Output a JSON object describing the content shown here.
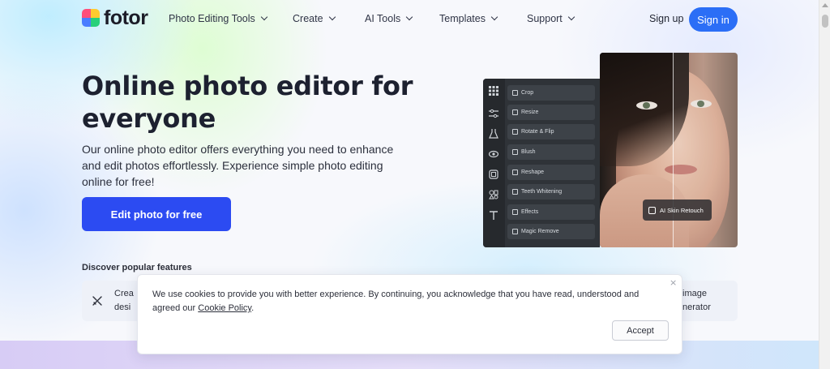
{
  "brand": {
    "name": "fotor"
  },
  "nav": {
    "items": [
      {
        "label": "Photo Editing Tools"
      },
      {
        "label": "Create"
      },
      {
        "label": "AI Tools"
      },
      {
        "label": "Templates"
      },
      {
        "label": "Support"
      }
    ],
    "signup_label": "Sign up",
    "signin_label": "Sign in"
  },
  "hero": {
    "title": "Online photo editor for everyone",
    "description": "Our online photo editor offers everything you need to enhance and edit photos effortlessly. Experience simple photo editing online for free!",
    "cta_label": "Edit photo for free"
  },
  "features": {
    "heading": "Discover popular features",
    "left_card_text": "Crea\ndesi",
    "right_card_text": "image\nnerator"
  },
  "editor_demo": {
    "tools": [
      "Crop",
      "Resize",
      "Rotate & Flip",
      "Blush",
      "Reshape",
      "Teeth Whitening",
      "Effects",
      "Magic Remove"
    ],
    "badge_label": "AI Skin Retouch"
  },
  "cookie": {
    "text": "We use cookies to provide you with better experience. By continuing, you acknowledge that you have read, understood and agreed our",
    "link_label": "Cookie Policy",
    "close_symbol": "×",
    "accept_label": "Accept"
  },
  "colors": {
    "primary_blue": "#2b6ef6",
    "cta_blue": "#2c4bf2",
    "text_dark": "#1d2130"
  }
}
